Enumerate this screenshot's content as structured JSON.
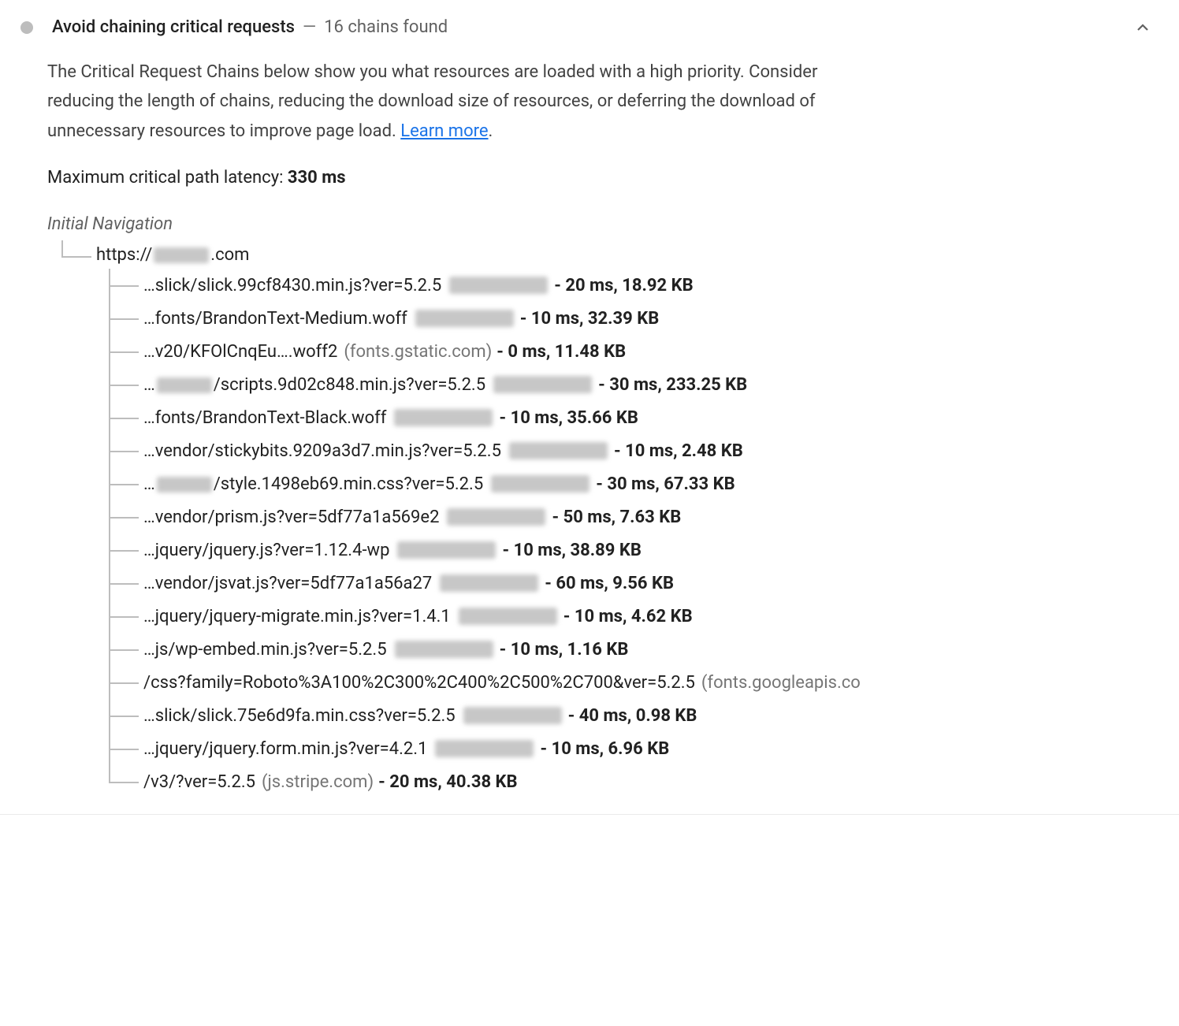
{
  "audit": {
    "title": "Avoid chaining critical requests",
    "separator": "—",
    "chains_found": "16 chains found",
    "description_pre": "The Critical Request Chains below show you what resources are loaded with a high priority. Consider reducing the length of chains, reducing the download size of resources, or deferring the download of unnecessary resources to improve page load. ",
    "learn_more": "Learn more",
    "description_post": ".",
    "latency_label": "Maximum critical path latency: ",
    "latency_value": "330 ms",
    "initial_nav": "Initial Navigation",
    "root_url_prefix": "https://",
    "root_url_suffix": ".com",
    "items": [
      {
        "path": "…slick/slick.99cf8430.min.js?ver=5.2.5",
        "has_blur_domain": true,
        "domain": "",
        "time": "20 ms",
        "size": "18.92 KB"
      },
      {
        "path": "…fonts/BrandonText-Medium.woff",
        "has_blur_domain": true,
        "domain": "",
        "time": "10 ms",
        "size": "32.39 KB"
      },
      {
        "path": "…v20/KFOlCnqEu….woff2",
        "has_blur_domain": false,
        "domain": "(fonts.gstatic.com)",
        "time": "0 ms",
        "size": "11.48 KB"
      },
      {
        "path_pre": "…",
        "path_blur": true,
        "path_post": "/scripts.9d02c848.min.js?ver=5.2.5",
        "has_blur_domain": true,
        "domain": "",
        "time": "30 ms",
        "size": "233.25 KB"
      },
      {
        "path": "…fonts/BrandonText-Black.woff",
        "has_blur_domain": true,
        "domain": "",
        "time": "10 ms",
        "size": "35.66 KB"
      },
      {
        "path": "…vendor/stickybits.9209a3d7.min.js?ver=5.2.5",
        "has_blur_domain": true,
        "domain": "",
        "time": "10 ms",
        "size": "2.48 KB"
      },
      {
        "path_pre": "…",
        "path_blur": true,
        "path_post": "/style.1498eb69.min.css?ver=5.2.5",
        "has_blur_domain": true,
        "domain": "",
        "time": "30 ms",
        "size": "67.33 KB"
      },
      {
        "path": "…vendor/prism.js?ver=5df77a1a569e2",
        "has_blur_domain": true,
        "domain": "",
        "time": "50 ms",
        "size": "7.63 KB"
      },
      {
        "path": "…jquery/jquery.js?ver=1.12.4-wp",
        "has_blur_domain": true,
        "domain": "",
        "time": "10 ms",
        "size": "38.89 KB"
      },
      {
        "path": "…vendor/jsvat.js?ver=5df77a1a56a27",
        "has_blur_domain": true,
        "domain": "",
        "time": "60 ms",
        "size": "9.56 KB"
      },
      {
        "path": "…jquery/jquery-migrate.min.js?ver=1.4.1",
        "has_blur_domain": true,
        "domain": "",
        "time": "10 ms",
        "size": "4.62 KB"
      },
      {
        "path": "…js/wp-embed.min.js?ver=5.2.5",
        "has_blur_domain": true,
        "domain": "",
        "time": "10 ms",
        "size": "1.16 KB"
      },
      {
        "path": "/css?family=Roboto%3A100%2C300%2C400%2C500%2C700&ver=5.2.5",
        "has_blur_domain": false,
        "domain": "(fonts.googleapis.co",
        "no_metrics": true
      },
      {
        "path": "…slick/slick.75e6d9fa.min.css?ver=5.2.5",
        "has_blur_domain": true,
        "domain": "",
        "time": "40 ms",
        "size": "0.98 KB"
      },
      {
        "path": "…jquery/jquery.form.min.js?ver=4.2.1",
        "has_blur_domain": true,
        "domain": "",
        "time": "10 ms",
        "size": "6.96 KB"
      },
      {
        "path": "/v3/?ver=5.2.5",
        "has_blur_domain": false,
        "domain": "(js.stripe.com)",
        "time": "20 ms",
        "size": "40.38 KB"
      }
    ]
  }
}
